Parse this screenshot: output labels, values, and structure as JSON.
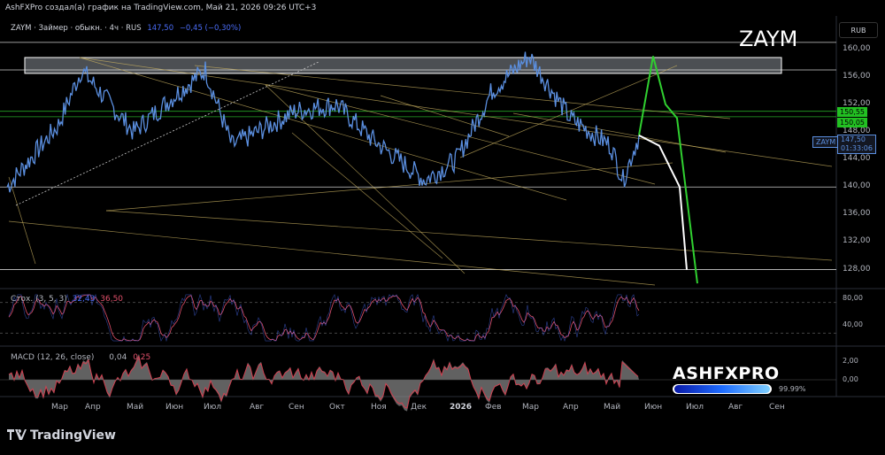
{
  "header": {
    "credit": "AshFXPro создал(а) график на TradingView.com, Май 21, 2026 09:26 UTC+3",
    "symbol_line": "ZAYM · Займер · обыкн. · 4ч · RUS",
    "last_price": "147,50",
    "change": "−0,45 (−0,30%)",
    "big_symbol": "ZAYM",
    "currency": "RUB"
  },
  "price_axis": {
    "ticks": [
      "160,00",
      "156,00",
      "152,00",
      "148,00",
      "144,00",
      "140,00",
      "136,00",
      "132,00",
      "128,00"
    ],
    "tag_green_1": "150,55",
    "tag_green_2": "150,05",
    "tag_symbol": "ZAYM",
    "tag_price": "147,50",
    "tag_countdown": "01:33:06"
  },
  "stoch": {
    "label": "Стох. (3, 5, 3)",
    "k": "32,43",
    "d": "36,50",
    "ticks": [
      "80,00",
      "40,00"
    ]
  },
  "macd": {
    "label": "MACD (12, 26, close)",
    "v1": "0,04",
    "v2": "0,25",
    "ticks": [
      "2,00",
      "0,00"
    ]
  },
  "time_axis": [
    "Мар",
    "Апр",
    "Май",
    "Июн",
    "Июл",
    "Авг",
    "Сен",
    "Окт",
    "Ноя",
    "Дек",
    "2026",
    "Фев",
    "Мар",
    "Апр",
    "Май",
    "Июн",
    "Июл",
    "Авг",
    "Сен"
  ],
  "watermark": {
    "brand": "ASHFXPRO",
    "progress_pct": "99.99%",
    "progress": 0.9999
  },
  "footer": {
    "logo_text": "TradingView"
  },
  "colors": {
    "price_line": "#5b8fe0",
    "stoch_k": "#4a6cf7",
    "stoch_d": "#e0506a",
    "macd_area": "#8a8a8a",
    "macd_line": "#d04050",
    "green_proj": "#30d030",
    "white_proj": "#ffffff",
    "trend": "#c8b060",
    "level": "#ffffff"
  },
  "chart_data": [
    {
      "type": "line",
      "title": "ZAYM · Займер · обыкн. · 4ч · RUS",
      "ylabel": "RUB",
      "ylim": [
        125.5,
        161.5
      ],
      "x": [
        "2025-02",
        "2025-03",
        "2025-04",
        "2025-05",
        "2025-06",
        "2025-07",
        "2025-08",
        "2025-09",
        "2025-10",
        "2025-11",
        "2025-12",
        "2026-01",
        "2026-02",
        "2026-03",
        "2026-04",
        "2026-05",
        "2026-06",
        "2026-07",
        "2026-08",
        "2026-09"
      ],
      "series": [
        {
          "name": "ZAYM",
          "values": [
            140,
            149,
            157,
            148,
            153,
            157,
            146,
            151,
            152,
            147,
            141,
            144,
            154,
            159,
            150,
            146,
            141,
            147.5,
            null,
            null
          ]
        }
      ],
      "levels": [
        161,
        157,
        151,
        150.2,
        140,
        128
      ],
      "zone": [
        156.5,
        158.8
      ],
      "projection_green": [
        147.5,
        159,
        152,
        150,
        126
      ],
      "projection_white": [
        147.5,
        146,
        140,
        128
      ]
    },
    {
      "type": "line",
      "title": "Стох. (3, 5, 3)",
      "ylim": [
        0,
        100
      ],
      "series": [
        {
          "name": "K",
          "values": [
            32.43
          ]
        },
        {
          "name": "D",
          "values": [
            36.5
          ]
        }
      ]
    },
    {
      "type": "area",
      "title": "MACD (12, 26, close)",
      "ylim": [
        -3,
        3
      ],
      "series": [
        {
          "name": "MACD",
          "values": [
            0.04
          ]
        },
        {
          "name": "Signal",
          "values": [
            0.25
          ]
        }
      ]
    }
  ]
}
